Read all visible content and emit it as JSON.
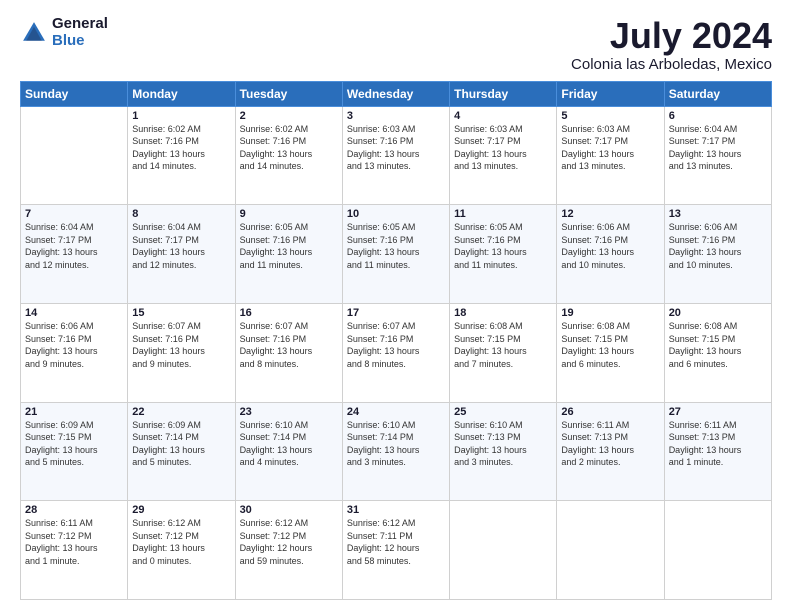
{
  "logo": {
    "general": "General",
    "blue": "Blue"
  },
  "title": {
    "month_year": "July 2024",
    "location": "Colonia las Arboledas, Mexico"
  },
  "days_of_week": [
    "Sunday",
    "Monday",
    "Tuesday",
    "Wednesday",
    "Thursday",
    "Friday",
    "Saturday"
  ],
  "weeks": [
    [
      {
        "day": "",
        "info": ""
      },
      {
        "day": "1",
        "info": "Sunrise: 6:02 AM\nSunset: 7:16 PM\nDaylight: 13 hours\nand 14 minutes."
      },
      {
        "day": "2",
        "info": "Sunrise: 6:02 AM\nSunset: 7:16 PM\nDaylight: 13 hours\nand 14 minutes."
      },
      {
        "day": "3",
        "info": "Sunrise: 6:03 AM\nSunset: 7:16 PM\nDaylight: 13 hours\nand 13 minutes."
      },
      {
        "day": "4",
        "info": "Sunrise: 6:03 AM\nSunset: 7:17 PM\nDaylight: 13 hours\nand 13 minutes."
      },
      {
        "day": "5",
        "info": "Sunrise: 6:03 AM\nSunset: 7:17 PM\nDaylight: 13 hours\nand 13 minutes."
      },
      {
        "day": "6",
        "info": "Sunrise: 6:04 AM\nSunset: 7:17 PM\nDaylight: 13 hours\nand 13 minutes."
      }
    ],
    [
      {
        "day": "7",
        "info": "Sunrise: 6:04 AM\nSunset: 7:17 PM\nDaylight: 13 hours\nand 12 minutes."
      },
      {
        "day": "8",
        "info": "Sunrise: 6:04 AM\nSunset: 7:17 PM\nDaylight: 13 hours\nand 12 minutes."
      },
      {
        "day": "9",
        "info": "Sunrise: 6:05 AM\nSunset: 7:16 PM\nDaylight: 13 hours\nand 11 minutes."
      },
      {
        "day": "10",
        "info": "Sunrise: 6:05 AM\nSunset: 7:16 PM\nDaylight: 13 hours\nand 11 minutes."
      },
      {
        "day": "11",
        "info": "Sunrise: 6:05 AM\nSunset: 7:16 PM\nDaylight: 13 hours\nand 11 minutes."
      },
      {
        "day": "12",
        "info": "Sunrise: 6:06 AM\nSunset: 7:16 PM\nDaylight: 13 hours\nand 10 minutes."
      },
      {
        "day": "13",
        "info": "Sunrise: 6:06 AM\nSunset: 7:16 PM\nDaylight: 13 hours\nand 10 minutes."
      }
    ],
    [
      {
        "day": "14",
        "info": "Sunrise: 6:06 AM\nSunset: 7:16 PM\nDaylight: 13 hours\nand 9 minutes."
      },
      {
        "day": "15",
        "info": "Sunrise: 6:07 AM\nSunset: 7:16 PM\nDaylight: 13 hours\nand 9 minutes."
      },
      {
        "day": "16",
        "info": "Sunrise: 6:07 AM\nSunset: 7:16 PM\nDaylight: 13 hours\nand 8 minutes."
      },
      {
        "day": "17",
        "info": "Sunrise: 6:07 AM\nSunset: 7:16 PM\nDaylight: 13 hours\nand 8 minutes."
      },
      {
        "day": "18",
        "info": "Sunrise: 6:08 AM\nSunset: 7:15 PM\nDaylight: 13 hours\nand 7 minutes."
      },
      {
        "day": "19",
        "info": "Sunrise: 6:08 AM\nSunset: 7:15 PM\nDaylight: 13 hours\nand 6 minutes."
      },
      {
        "day": "20",
        "info": "Sunrise: 6:08 AM\nSunset: 7:15 PM\nDaylight: 13 hours\nand 6 minutes."
      }
    ],
    [
      {
        "day": "21",
        "info": "Sunrise: 6:09 AM\nSunset: 7:15 PM\nDaylight: 13 hours\nand 5 minutes."
      },
      {
        "day": "22",
        "info": "Sunrise: 6:09 AM\nSunset: 7:14 PM\nDaylight: 13 hours\nand 5 minutes."
      },
      {
        "day": "23",
        "info": "Sunrise: 6:10 AM\nSunset: 7:14 PM\nDaylight: 13 hours\nand 4 minutes."
      },
      {
        "day": "24",
        "info": "Sunrise: 6:10 AM\nSunset: 7:14 PM\nDaylight: 13 hours\nand 3 minutes."
      },
      {
        "day": "25",
        "info": "Sunrise: 6:10 AM\nSunset: 7:13 PM\nDaylight: 13 hours\nand 3 minutes."
      },
      {
        "day": "26",
        "info": "Sunrise: 6:11 AM\nSunset: 7:13 PM\nDaylight: 13 hours\nand 2 minutes."
      },
      {
        "day": "27",
        "info": "Sunrise: 6:11 AM\nSunset: 7:13 PM\nDaylight: 13 hours\nand 1 minute."
      }
    ],
    [
      {
        "day": "28",
        "info": "Sunrise: 6:11 AM\nSunset: 7:12 PM\nDaylight: 13 hours\nand 1 minute."
      },
      {
        "day": "29",
        "info": "Sunrise: 6:12 AM\nSunset: 7:12 PM\nDaylight: 13 hours\nand 0 minutes."
      },
      {
        "day": "30",
        "info": "Sunrise: 6:12 AM\nSunset: 7:12 PM\nDaylight: 12 hours\nand 59 minutes."
      },
      {
        "day": "31",
        "info": "Sunrise: 6:12 AM\nSunset: 7:11 PM\nDaylight: 12 hours\nand 58 minutes."
      },
      {
        "day": "",
        "info": ""
      },
      {
        "day": "",
        "info": ""
      },
      {
        "day": "",
        "info": ""
      }
    ]
  ]
}
